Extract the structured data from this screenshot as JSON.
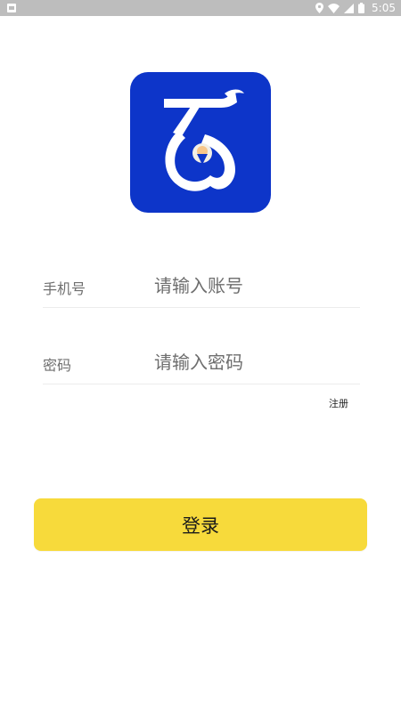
{
  "status_bar": {
    "time": "5:05",
    "icons": [
      "location-icon",
      "wifi-icon",
      "signal-icon",
      "battery-icon"
    ]
  },
  "logo": {
    "icon": "app-logo-icon",
    "background_color": "#0d35c9"
  },
  "form": {
    "phone": {
      "label": "手机号",
      "placeholder": "请输入账号",
      "value": ""
    },
    "password": {
      "label": "密码",
      "placeholder": "请输入密码",
      "value": ""
    },
    "register_label": "注册"
  },
  "login_button": {
    "label": "登录",
    "color": "#f7da3b"
  }
}
